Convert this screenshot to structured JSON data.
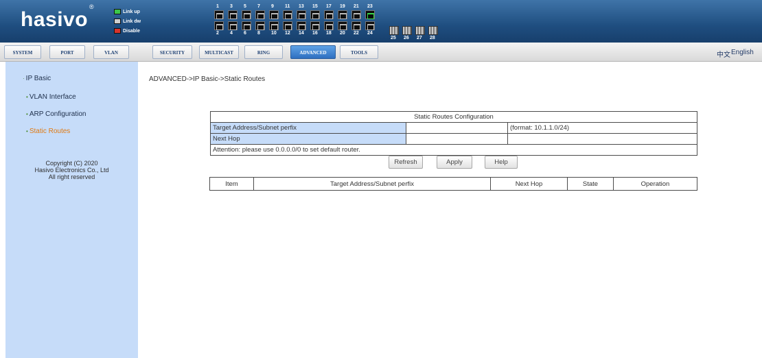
{
  "brand": {
    "logo": "hasivo",
    "registered": "®"
  },
  "legend": [
    {
      "label": "Link up",
      "color": "#3cc84a"
    },
    {
      "label": "Link dw",
      "color": "#cfcfcf"
    },
    {
      "label": "Disable",
      "color": "#d8342c"
    }
  ],
  "ports": {
    "top_numbers": [
      "1",
      "3",
      "5",
      "7",
      "9",
      "11",
      "13",
      "15",
      "17",
      "19",
      "21",
      "23"
    ],
    "bottom_numbers": [
      "2",
      "4",
      "6",
      "8",
      "10",
      "12",
      "14",
      "16",
      "18",
      "20",
      "22",
      "24",
      "25",
      "26",
      "27",
      "28"
    ],
    "link_up_ports": [
      "23"
    ]
  },
  "nav": {
    "items": [
      "SYSTEM",
      "PORT",
      "VLAN",
      "SECURITY",
      "MULTICAST",
      "RING",
      "ADVANCED",
      "TOOLS"
    ],
    "active": "ADVANCED",
    "lang_cn": "中文",
    "lang_en": "English"
  },
  "sidebar": {
    "group": "IP Basic",
    "items": [
      "VLAN Interface",
      "ARP Configuration",
      "Static Routes"
    ],
    "current": "Static Routes",
    "copyright": [
      "Copyright (C) 2020",
      "Hasivo Electronics Co., Ltd",
      "All right reserved"
    ]
  },
  "breadcrumb": "ADVANCED->IP Basic->Static Routes",
  "config": {
    "title": "Static Routes Configuration",
    "target_label": "Target Address/Subnet perfix",
    "target_value": "",
    "target_hint": "(format: 10.1.1.0/24)",
    "nexthop_label": "Next Hop",
    "nexthop_value": "",
    "attention": "Attention: please use 0.0.0.0/0 to set default router."
  },
  "buttons": {
    "refresh": "Refresh",
    "apply": "Apply",
    "help": "Help"
  },
  "table": {
    "columns": [
      "Item",
      "Target Address/Subnet perfix",
      "Next Hop",
      "State",
      "Operation"
    ],
    "rows": []
  },
  "colors": {
    "header": "#1f4e80",
    "sidebar": "#c6dcf9",
    "nav_active": "#2e6fc0",
    "current_item": "#e07a12"
  }
}
